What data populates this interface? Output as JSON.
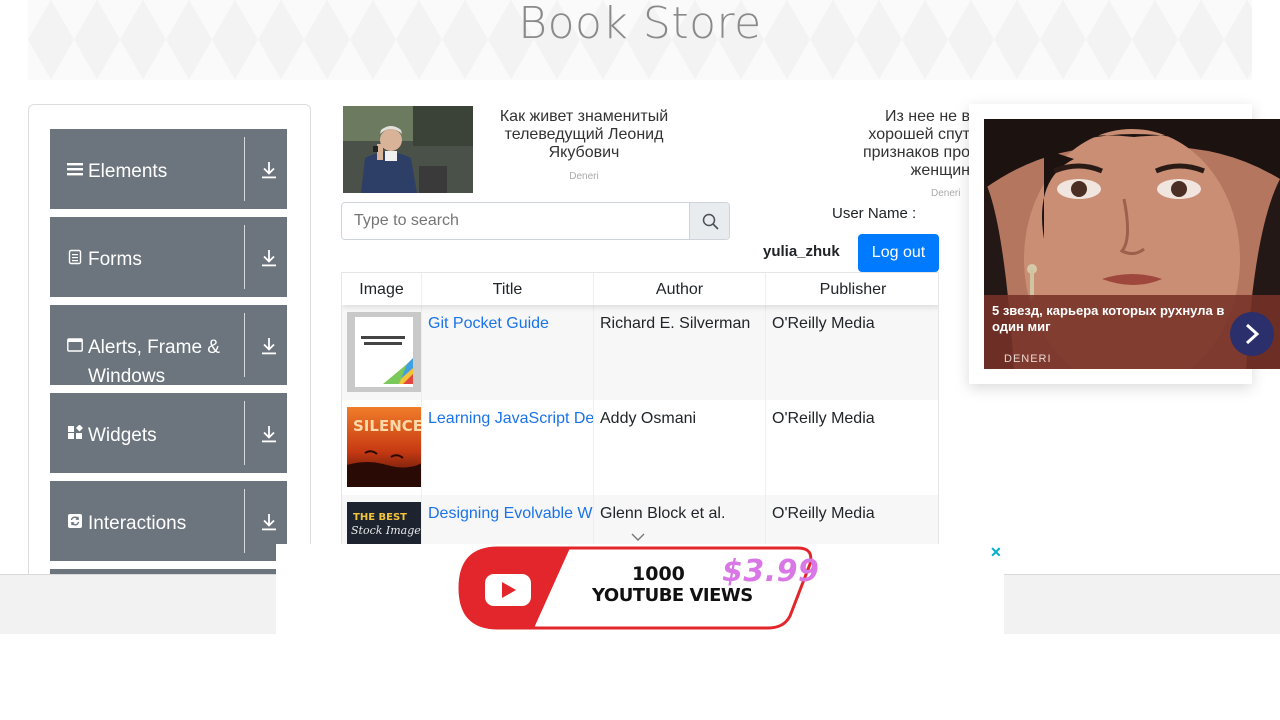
{
  "header": {
    "title": "Book Store"
  },
  "sidebar": {
    "groups": [
      {
        "label": "Elements",
        "icon": "list-icon"
      },
      {
        "label": "Forms",
        "icon": "document-icon"
      },
      {
        "label": "Alerts, Frame & Windows",
        "icon": "window-icon"
      },
      {
        "label": "Widgets",
        "icon": "widgets-icon"
      },
      {
        "label": "Interactions",
        "icon": "interactions-icon"
      }
    ]
  },
  "ads": {
    "top_left": {
      "text": "Как живет знаменитый телеведущий Леонид Якубович",
      "source": "Deneri"
    },
    "top_right": {
      "text": "Из нее не в... хорошей спут... признаков про... женщин",
      "source": "Deneri"
    },
    "right": {
      "text": "5 звезд, карьера которых рухнула в один миг",
      "source": "DENERI"
    },
    "bottom": {
      "line1": "1000",
      "line2": "YOUTUBE VIEWS",
      "price": "$3.99",
      "close": "✕"
    }
  },
  "search": {
    "placeholder": "Type to search",
    "value": ""
  },
  "user": {
    "label": "User Name :",
    "value": "yulia_zhuk",
    "logout_label": "Log out"
  },
  "table": {
    "columns": [
      "Image",
      "Title",
      "Author",
      "Publisher"
    ],
    "rows": [
      {
        "title": "Git Pocket Guide",
        "author": "Richard E. Silverman",
        "publisher": "O'Reilly Media"
      },
      {
        "title": "Learning JavaScript Design Patterns",
        "author": "Addy Osmani",
        "publisher": "O'Reilly Media"
      },
      {
        "title": "Designing Evolvable Web APIs with ASP.NET",
        "author": "Glenn Block et al.",
        "publisher": "O'Reilly Media"
      }
    ]
  },
  "colors": {
    "sidebar_group": "#6c757d",
    "primary_button": "#007bff",
    "link": "#1a73e8"
  }
}
